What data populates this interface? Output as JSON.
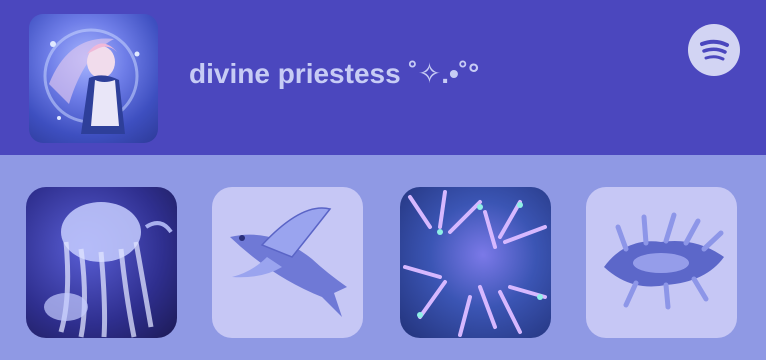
{
  "header": {
    "title": "divine priestess ˚✧.•˚°",
    "background_color": "#4b47be",
    "avatar_alt": "priestess artwork",
    "spotify_icon": "spotify-icon"
  },
  "tiles": [
    {
      "name": "jellyfish-image",
      "subject": "jellyfish"
    },
    {
      "name": "flying-fish-image",
      "subject": "flying fish"
    },
    {
      "name": "anemone-image",
      "subject": "sea anemone"
    },
    {
      "name": "nudibranch-image",
      "subject": "nudibranch"
    }
  ],
  "colors": {
    "accent": "#4b47be",
    "panel": "#8f99e4",
    "tile_light": "#c6c7f5",
    "text": "#c7ccf5"
  }
}
